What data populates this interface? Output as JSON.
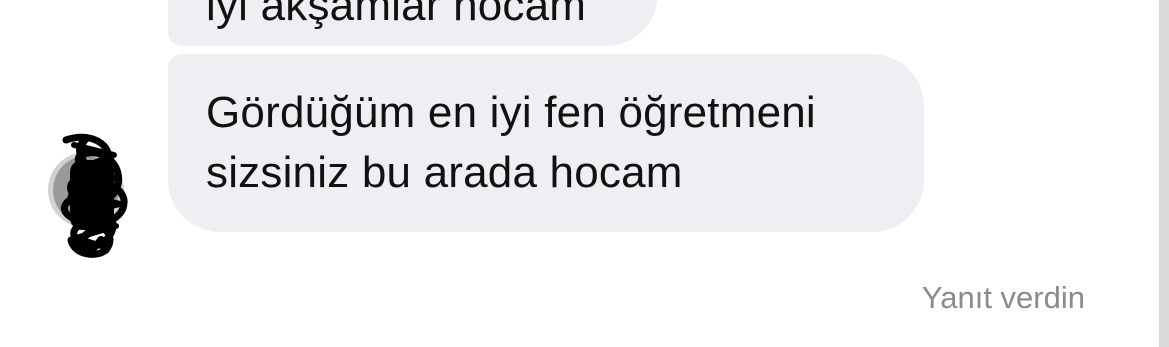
{
  "messages": {
    "previous": {
      "text": "iyi akşamlar hocam"
    },
    "main": {
      "line1": "Gördüğüm en iyi fen öğretmeni",
      "line2": "sizsiniz bu arada hocam"
    }
  },
  "status": {
    "label": "Yanıt verdin"
  },
  "avatar": {
    "icon": "scribbled-avatar"
  }
}
